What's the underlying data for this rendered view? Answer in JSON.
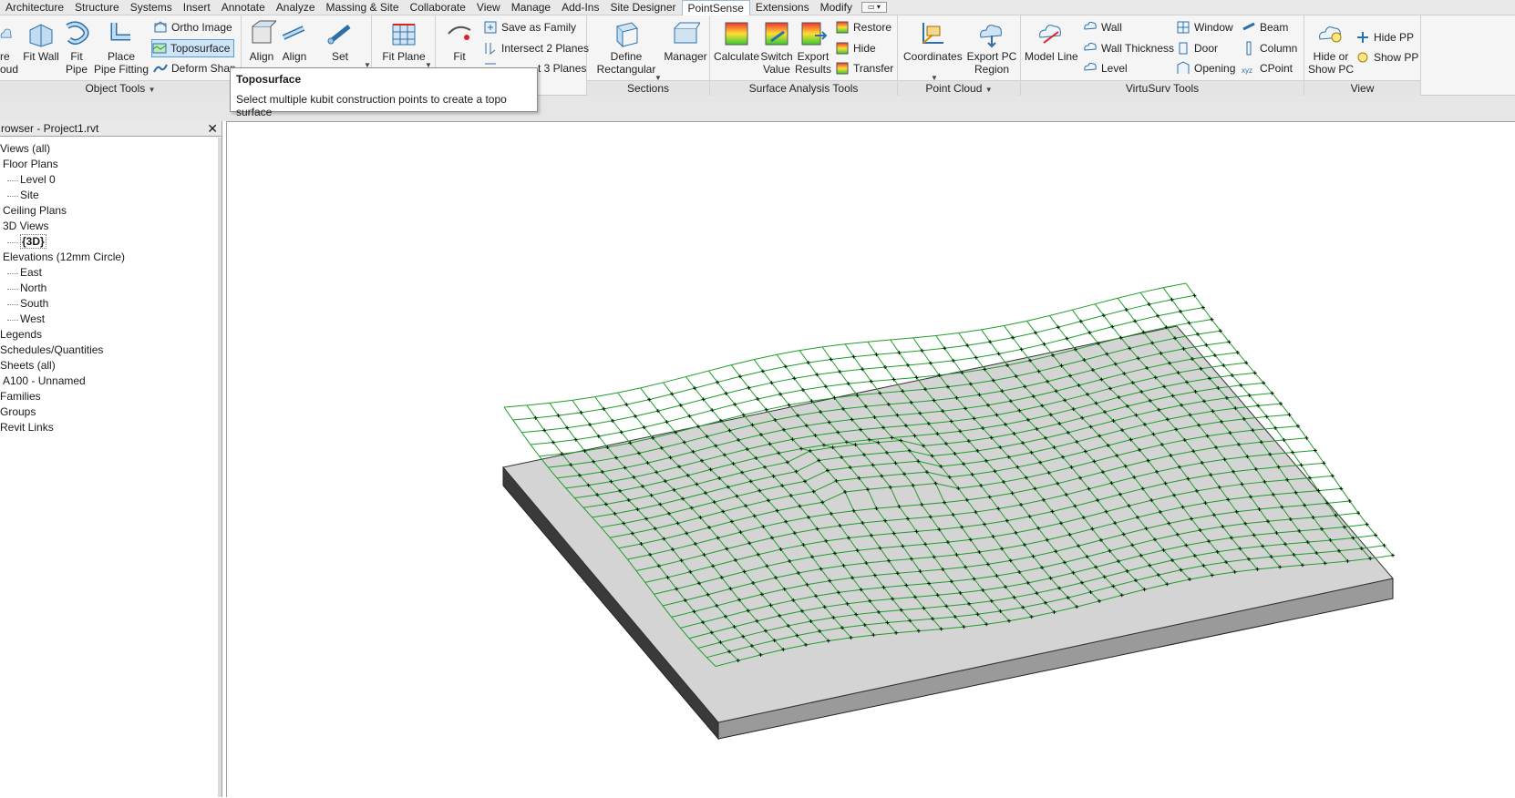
{
  "tabs": [
    "Architecture",
    "Structure",
    "Systems",
    "Insert",
    "Annotate",
    "Analyze",
    "Massing & Site",
    "Collaborate",
    "View",
    "Manage",
    "Add-Ins",
    "Site Designer",
    "PointSense",
    "Extensions",
    "Modify"
  ],
  "active_tab": "PointSense",
  "ribbon": {
    "object_tools": {
      "label": "Object Tools",
      "cloud_partial": "re\noud",
      "fit_wall": "Fit Wall",
      "fit_pipe": "Fit\nPipe",
      "place_pipe_fitting": "Place\nPipe Fitting",
      "ortho_image": "Ortho Image",
      "toposurface": "Toposurface",
      "deform_shape": "Deform Shap"
    },
    "align_group": {
      "align1": "Align",
      "align2": "Align",
      "set": "Set"
    },
    "fit_plane": "Fit Plane",
    "fit": "Fit",
    "planes_group": {
      "save_as_family": "Save as Family",
      "intersect_2_planes": "Intersect 2 Planes",
      "intersect_3_planes": "t 3 Planes"
    },
    "sections": {
      "label": "Sections",
      "define_rectangular": "Define\nRectangular",
      "manager": "Manager"
    },
    "surface_analysis": {
      "label": "Surface Analysis Tools",
      "calculate": "Calculate",
      "switch_value": "Switch\nValue",
      "export_results": "Export\nResults",
      "restore": "Restore",
      "hide": "Hide",
      "transfer": "Transfer"
    },
    "point_cloud": {
      "label": "Point Cloud",
      "coordinates": "Coordinates",
      "export_pc_region": "Export PC\nRegion"
    },
    "virtusurv": {
      "label": "VirtuSurv Tools",
      "model_line": "Model Line",
      "wall": "Wall",
      "wall_thickness": "Wall Thickness",
      "level": "Level",
      "window": "Window",
      "door": "Door",
      "opening": "Opening",
      "beam": "Beam",
      "column": "Column",
      "cpoint": "CPoint"
    },
    "view": {
      "label": "View",
      "hide_or_show_pc": "Hide or\nShow PC",
      "hide_pp": "Hide PP",
      "show_pp": "Show PP"
    }
  },
  "tooltip": {
    "title": "Toposurface",
    "description": "Select multiple kubit construction points to create a topo surface"
  },
  "browser": {
    "title": "rowser - Project1.rvt",
    "close": "✕",
    "nodes": [
      {
        "text": "Views (all)",
        "level": 0
      },
      {
        "text": "Floor Plans",
        "level": 1
      },
      {
        "text": "Level 0",
        "level": 2
      },
      {
        "text": "Site",
        "level": 2
      },
      {
        "text": "Ceiling Plans",
        "level": 1
      },
      {
        "text": "3D Views",
        "level": 1
      },
      {
        "text": "{3D}",
        "level": 2,
        "bold": true
      },
      {
        "text": "Elevations (12mm Circle)",
        "level": 1
      },
      {
        "text": "East",
        "level": 2
      },
      {
        "text": "North",
        "level": 2
      },
      {
        "text": "South",
        "level": 2
      },
      {
        "text": "West",
        "level": 2
      },
      {
        "text": "Legends",
        "level": 0
      },
      {
        "text": "Schedules/Quantities",
        "level": 0
      },
      {
        "text": "Sheets (all)",
        "level": 0
      },
      {
        "text": "A100 - Unnamed",
        "level": 1
      },
      {
        "text": "Families",
        "level": 0
      },
      {
        "text": "Groups",
        "level": 0
      },
      {
        "text": "Revit Links",
        "level": 0
      }
    ]
  },
  "colors": {
    "mesh": "#1f9e2a",
    "slab_top": "#d4d4d4",
    "slab_side": "#3a3a3a",
    "slab_front": "#9a9a9a",
    "selection": "#cde4f7"
  }
}
